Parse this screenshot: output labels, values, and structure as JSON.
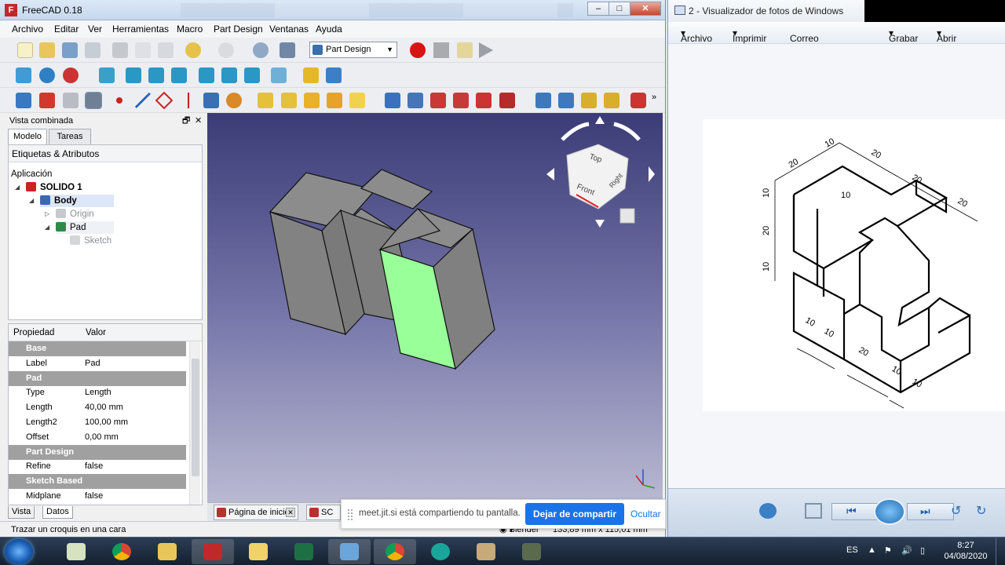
{
  "freecad": {
    "title": "FreeCAD 0.18",
    "menu": [
      "Archivo",
      "Editar",
      "Ver",
      "Herramientas",
      "Macro",
      "Part Design",
      "Ventanas",
      "Ayuda"
    ],
    "workbench": "Part Design",
    "combo": {
      "header": "Vista combinada",
      "tabs": [
        "Modelo",
        "Tareas"
      ],
      "tree_header": "Etiquetas & Atributos",
      "tree": {
        "root": "Aplicación",
        "document": "SOLIDO 1",
        "body": "Body",
        "origin": "Origin",
        "pad": "Pad",
        "sketch": "Sketch"
      },
      "props_header": {
        "property": "Propiedad",
        "value": "Valor"
      },
      "props": [
        {
          "group": true,
          "key": "Base"
        },
        {
          "key": "Label",
          "value": "Pad"
        },
        {
          "group": true,
          "key": "Pad"
        },
        {
          "key": "Type",
          "value": "Length"
        },
        {
          "key": "Length",
          "value": "40,00 mm"
        },
        {
          "key": "Length2",
          "value": "100,00 mm"
        },
        {
          "key": "Offset",
          "value": "0,00 mm"
        },
        {
          "group": true,
          "key": "Part Design"
        },
        {
          "key": "Refine",
          "value": "false"
        },
        {
          "group": true,
          "key": "Sketch Based"
        },
        {
          "key": "Midplane",
          "value": "false"
        }
      ],
      "bottom_tabs": [
        "Vista",
        "Datos"
      ]
    },
    "navcube": {
      "top": "Top",
      "front": "Front",
      "right": "Right"
    },
    "doc_tabs": [
      "Página de inicio",
      "SC"
    ],
    "status": {
      "message": "Trazar un croquis en una cara",
      "nav_style": "Blender",
      "dimensions": "133,89 mm x 115,01 mm"
    },
    "colors": {
      "selected_face": "#99ff99",
      "solid": "#8c8c8c",
      "accent": "#1a73e8"
    }
  },
  "share_banner": {
    "message": "meet.jit.si está compartiendo tu pantalla.",
    "stop_label": "Dejar de compartir",
    "hide_label": "Ocultar"
  },
  "photo_viewer": {
    "title": "2 - Visualizador de fotos de Windows",
    "menu": [
      "Archivo",
      "Imprimir",
      "Correo electrónico",
      "Grabar",
      "Abrir"
    ],
    "drawing_dims": [
      "20",
      "10",
      "20",
      "20",
      "20",
      "10",
      "10",
      "20",
      "10",
      "10",
      "10",
      "20",
      "10",
      "10"
    ]
  },
  "taskbar": {
    "lang": "ES",
    "time": "8:27",
    "date": "04/08/2020"
  }
}
